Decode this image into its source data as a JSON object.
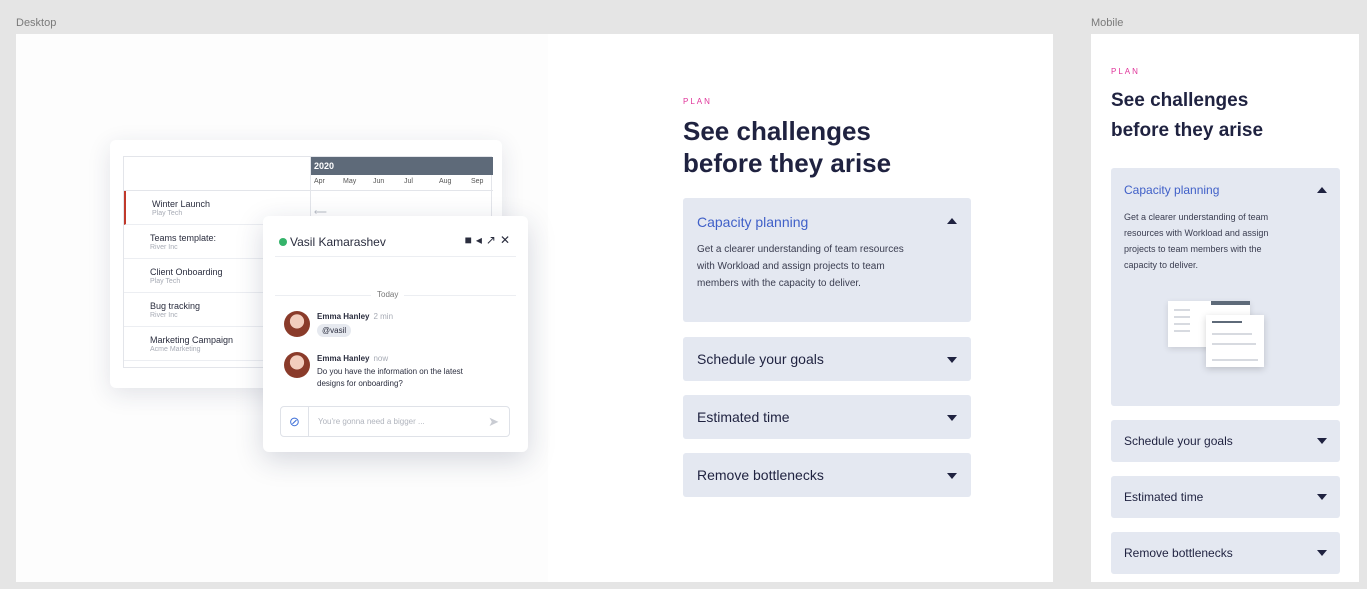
{
  "frames": {
    "desktop_label": "Desktop",
    "mobile_label": "Mobile"
  },
  "section": {
    "eyebrow": "PLAN",
    "headline_line1": "See challenges",
    "headline_line2": "before they arise"
  },
  "accordion": [
    {
      "title": "Capacity planning",
      "expanded": true,
      "body_desktop": [
        "Get a clearer understanding of team resources",
        "with Workload and assign projects to team",
        "members with the capacity to deliver."
      ],
      "body_mobile": [
        "Get a clearer understanding of team",
        "resources with Workload and assign",
        "projects to team members with the",
        "capacity to deliver."
      ]
    },
    {
      "title": "Schedule your goals",
      "expanded": false
    },
    {
      "title": "Estimated time",
      "expanded": false
    },
    {
      "title": "Remove bottlenecks",
      "expanded": false
    }
  ],
  "gantt": {
    "year": "2020",
    "months": [
      "Apr",
      "May",
      "Jun",
      "Jul",
      "Aug",
      "Sep"
    ],
    "rows": [
      {
        "name": "Winter Launch",
        "company": "Play Tech"
      },
      {
        "name": "Teams template:",
        "company": "River Inc"
      },
      {
        "name": "Client Onboarding",
        "company": "Play Tech"
      },
      {
        "name": "Bug tracking",
        "company": "River Inc"
      },
      {
        "name": "Marketing Campaign",
        "company": "Acme Marketing"
      }
    ]
  },
  "chat": {
    "contact": "Vasil Kamarashev",
    "day_separator": "Today",
    "messages": [
      {
        "author": "Emma Hanley",
        "time": "2 min",
        "mention": "@vasil"
      },
      {
        "author": "Emma Hanley",
        "time": "now",
        "text_line1": "Do you have the information on the latest",
        "text_line2": "designs for onboarding?"
      }
    ],
    "input_placeholder": "You're gonna need a bigger ..."
  },
  "colors": {
    "accent_pink": "#e0349a",
    "accordion_bg": "#e4e8f1",
    "link_blue": "#4060c8",
    "online_green": "#34b36a"
  },
  "icons": [
    "video-icon",
    "popout-icon",
    "close-icon",
    "attach-icon",
    "send-icon",
    "caret-up-icon",
    "caret-down-icon"
  ]
}
